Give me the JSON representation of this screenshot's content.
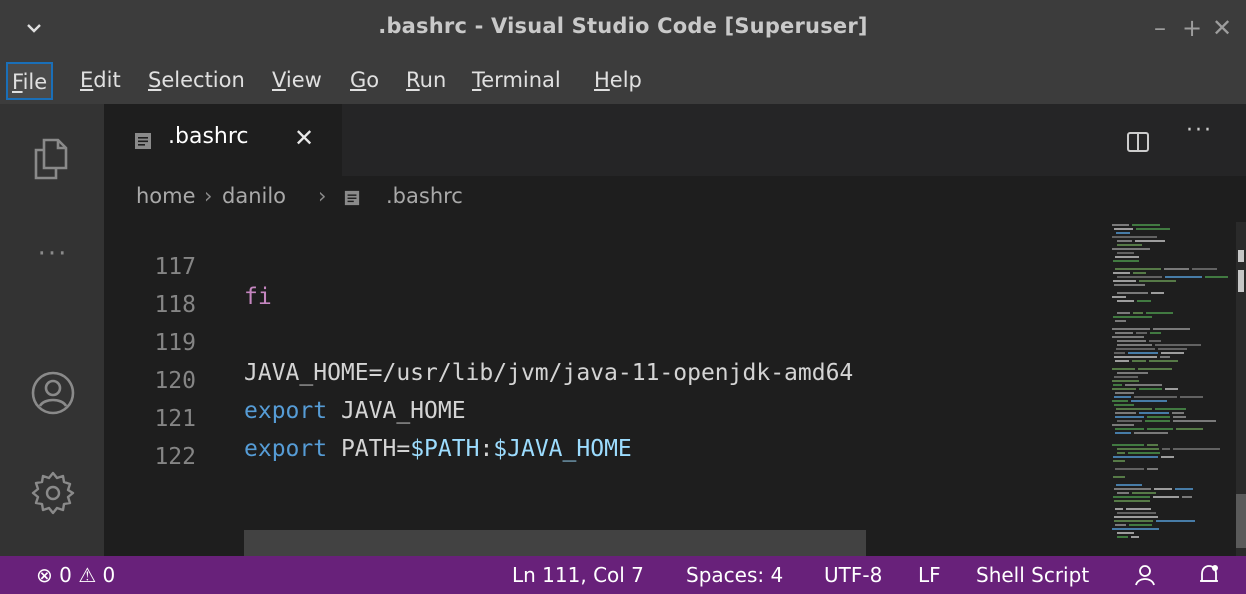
{
  "window": {
    "title": ".bashrc - Visual Studio Code [Superuser]",
    "controls": [
      "–",
      "+",
      "✕"
    ]
  },
  "menubar": {
    "items": [
      {
        "mnemonic": "F",
        "rest": "ile"
      },
      {
        "mnemonic": "E",
        "rest": "dit"
      },
      {
        "mnemonic": "S",
        "rest": "election"
      },
      {
        "mnemonic": "V",
        "rest": "iew"
      },
      {
        "mnemonic": "G",
        "rest": "o"
      },
      {
        "mnemonic": "R",
        "rest": "un"
      },
      {
        "mnemonic": "T",
        "rest": "erminal"
      },
      {
        "mnemonic": "H",
        "rest": "elp"
      }
    ]
  },
  "activitybar": {
    "icons": [
      "explorer-icon",
      "more-icon",
      "account-icon",
      "settings-gear-icon"
    ],
    "more_glyph": "···"
  },
  "tabs": [
    {
      "label": ".bashrc",
      "close": "✕"
    }
  ],
  "tab_actions": {
    "more": "···"
  },
  "breadcrumb": {
    "parts": [
      "home",
      "danilo",
      ".bashrc"
    ],
    "separator": "›"
  },
  "editor": {
    "lines": [
      {
        "number": "117",
        "tokens": [
          {
            "text": "fi",
            "kind": "kw-fi"
          }
        ]
      },
      {
        "number": "118",
        "tokens": []
      },
      {
        "number": "119",
        "tokens": [
          {
            "text": "JAVA_HOME=/usr/lib/jvm/java-11-openjdk-amd64",
            "kind": "txt"
          }
        ]
      },
      {
        "number": "120",
        "tokens": [
          {
            "text": "export",
            "kind": "kw"
          },
          {
            "text": " JAVA_HOME",
            "kind": "txt"
          }
        ]
      },
      {
        "number": "121",
        "tokens": [
          {
            "text": "export",
            "kind": "kw"
          },
          {
            "text": " PATH=",
            "kind": "txt"
          },
          {
            "text": "$PATH",
            "kind": "var"
          },
          {
            "text": ":",
            "kind": "txt"
          },
          {
            "text": "$JAVA_HOME",
            "kind": "var"
          }
        ]
      },
      {
        "number": "122",
        "tokens": []
      }
    ]
  },
  "statusbar": {
    "errors": "0",
    "warnings": "0",
    "cursor": "Ln 111, Col 7",
    "spaces": "Spaces: 4",
    "encoding": "UTF-8",
    "eol": "LF",
    "language": "Shell Script"
  },
  "colors": {
    "statusbar": "#68217a",
    "titlebar": "#3c3c3c",
    "editor_bg": "#1e1e1e",
    "keyword": "#569cd6",
    "control_keyword": "#c586c0",
    "variable": "#9cdcfe"
  }
}
